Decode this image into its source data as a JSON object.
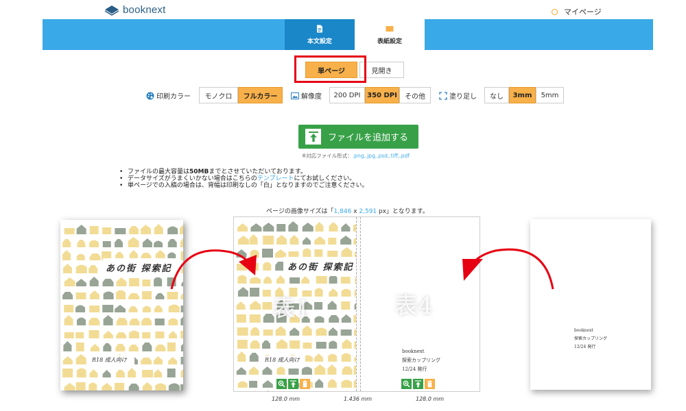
{
  "header": {
    "logo_text": "booknext",
    "mypage_label": "マイページ"
  },
  "tabs": [
    {
      "label": "本文設定",
      "icon": "document-icon"
    },
    {
      "label": "表紙設定",
      "icon": "book-icon"
    }
  ],
  "page_mode": {
    "single": "単ページ",
    "spread": "見開き",
    "selected": "単ページ"
  },
  "options": {
    "print_color": {
      "label": "印刷カラー",
      "choices": [
        "モノクロ",
        "フルカラー"
      ],
      "selected": "フルカラー"
    },
    "resolution": {
      "label": "解像度",
      "choices": [
        "200 DPI",
        "350 DPI",
        "その他"
      ],
      "selected": "350 DPI"
    },
    "bleed": {
      "label": "塗り足し",
      "choices": [
        "なし",
        "3mm",
        "5mm"
      ],
      "selected": "3mm"
    }
  },
  "add_file": {
    "label": "ファイルを追加する",
    "formats_prefix": "※対応ファイル形式：",
    "formats": ".png,.jpg,.psd,.tiff,.pdf"
  },
  "notes": {
    "line1_a": "ファイルの最大容量は",
    "line1_b": "50MB",
    "line1_c": "までとさせていただいております。",
    "line2_a": "データサイズがうまくいかない場合はこちらの",
    "line2_link": "テンプレート",
    "line2_b": "にてお試しください。",
    "line3": "単ページでの入稿の場合は、背幅は印刷なしの「白」となりますのでご注意ください。"
  },
  "image_size": {
    "prefix": "ページの画像サイズは「",
    "width": "1,846",
    "x": " x ",
    "height": "2,591",
    "suffix": " px」となります。"
  },
  "cover": {
    "title": "あの街 探索記",
    "rating": "R18 成人向け",
    "front_mark": "表1",
    "back_mark": "表4",
    "colophon_1": "booknext",
    "colophon_2": "探索カップリング",
    "colophon_3": "12/24 発行"
  },
  "dimensions": {
    "front": "128.0 mm",
    "spine": "1.436 mm",
    "back": "128.0 mm"
  },
  "colors": {
    "accent_blue": "#39a9e8",
    "tab_active": "#1a87c9",
    "orange": "#f7b04a",
    "green": "#38a148",
    "red": "#e60012",
    "house_yellow": "#f2dc95",
    "house_green": "#98a495"
  }
}
